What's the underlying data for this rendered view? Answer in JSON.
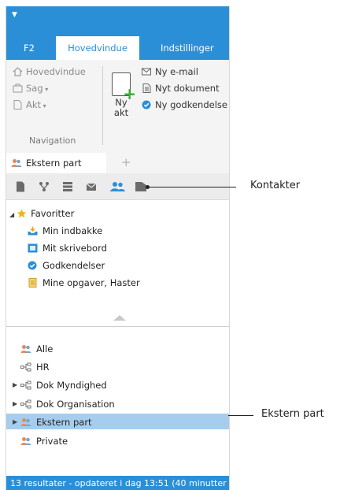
{
  "ribbon": {
    "tabs": [
      {
        "label": "F2",
        "active": false
      },
      {
        "label": "Hovedvindue",
        "active": true
      },
      {
        "label": "Indstillinger",
        "active": false
      }
    ],
    "navigation_group": {
      "items": [
        {
          "label": "Hovedvindue",
          "icon": "home-icon",
          "enabled": false
        },
        {
          "label": "Sag",
          "icon": "case-icon",
          "enabled": false
        },
        {
          "label": "Akt",
          "icon": "document-icon",
          "enabled": false
        }
      ],
      "caption": "Navigation"
    },
    "new_group": {
      "big_button": {
        "line1": "Ny",
        "line2": "akt",
        "icon": "new-document-icon"
      },
      "items": [
        {
          "label": "Ny e-mail",
          "icon": "new-email-icon"
        },
        {
          "label": "Nyt dokument",
          "icon": "new-doc-icon"
        },
        {
          "label": "Ny godkendelse",
          "icon": "approval-icon"
        }
      ]
    }
  },
  "doc_tabs": {
    "active": {
      "label": "Ekstern part",
      "icon": "persons-icon"
    },
    "add_icon": "plus-icon"
  },
  "toolbar": {
    "icons": [
      "document-icon",
      "workflow-icon",
      "list-icon",
      "mail-icon",
      "contacts-icon",
      "folder-icon"
    ]
  },
  "favorites": {
    "header": "Favoritter",
    "items": [
      {
        "label": "Min indbakke",
        "icon": "inbox-icon"
      },
      {
        "label": "Mit skrivebord",
        "icon": "desktop-icon"
      },
      {
        "label": "Godkendelser",
        "icon": "check-circle-icon"
      },
      {
        "label": "Mine opgaver, Haster",
        "icon": "task-icon"
      }
    ]
  },
  "tree": {
    "items": [
      {
        "label": "Alle",
        "icon": "persons-icon",
        "expandable": false,
        "selected": false
      },
      {
        "label": "HR",
        "icon": "org-icon",
        "expandable": false,
        "selected": false
      },
      {
        "label": "Dok Myndighed",
        "icon": "org-icon",
        "expandable": true,
        "selected": false
      },
      {
        "label": "Dok Organisation",
        "icon": "org-icon",
        "expandable": true,
        "selected": false
      },
      {
        "label": "Ekstern part",
        "icon": "persons-icon",
        "expandable": true,
        "selected": true
      },
      {
        "label": "Private",
        "icon": "persons-icon",
        "expandable": false,
        "selected": false
      }
    ]
  },
  "status_bar": {
    "text": "13 resultater - opdateret i dag 13:51 (40 minutter"
  },
  "callouts": {
    "kontakter": "Kontakter",
    "ekstern_part": "Ekstern part"
  },
  "colors": {
    "accent": "#2b8fd8",
    "selection": "#a7cdee",
    "favorite_star": "#f2b21b"
  }
}
